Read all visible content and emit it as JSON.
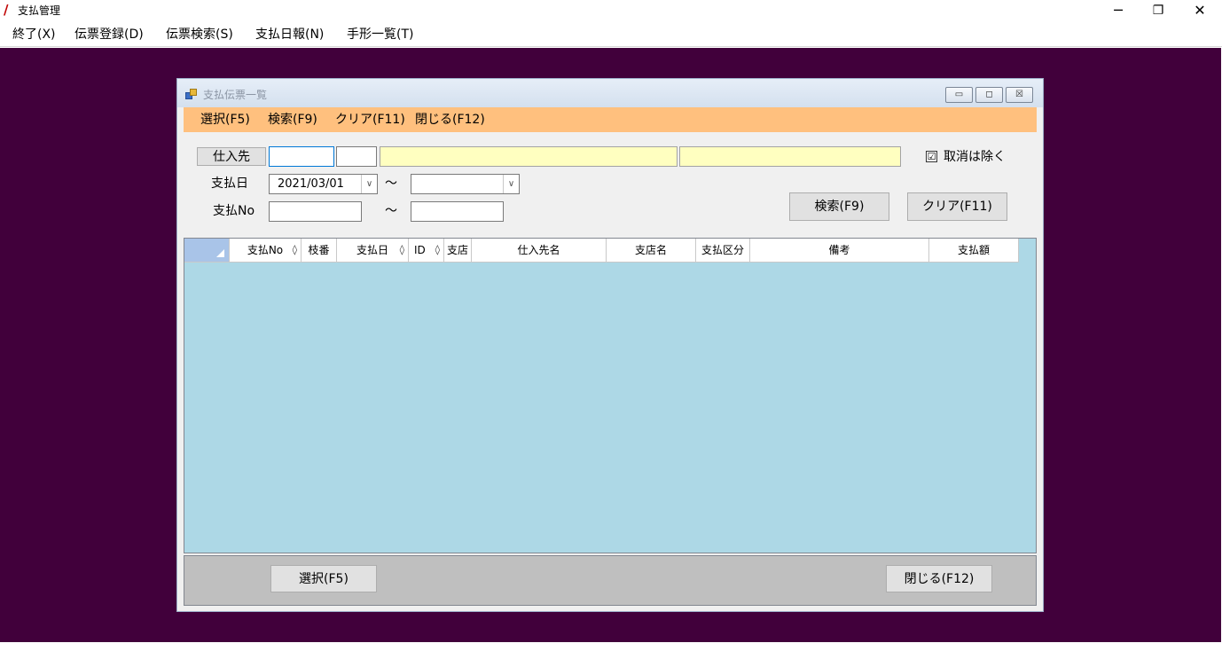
{
  "app": {
    "title": "支払管理",
    "icon": "app-logo-icon",
    "controls": {
      "minimize": "─",
      "restore": "❐",
      "close": "✕"
    }
  },
  "menubar": {
    "items": [
      "終了(X)",
      "伝票登録(D)",
      "伝票検索(S)",
      "支払日報(N)",
      "手形一覧(T)"
    ]
  },
  "child": {
    "title": "支払伝票一覧",
    "controls": {
      "minimize": "▭",
      "restore": "◻",
      "close": "☒"
    },
    "menu": [
      "選択(F5)",
      "検索(F9)",
      "クリア(F11)",
      "閉じる(F12)"
    ]
  },
  "form": {
    "supplier_button": "仕入先",
    "supplier_code": "",
    "supplier_branch": "",
    "supplier_name": "",
    "supplier_branch_name": "",
    "exclude_cancel_label": "取消は除く",
    "exclude_cancel_checked": "☑",
    "pay_date_label": "支払日",
    "pay_date_from": "2021/03/01",
    "pay_date_to": "",
    "tilde": "～",
    "pay_no_label": "支払No",
    "pay_no_from": "",
    "pay_no_to": "",
    "search_button": "検索(F9)",
    "clear_button": "クリア(F11)",
    "dropdown_arrow": "∨"
  },
  "grid": {
    "sort_glyph": "◊",
    "columns": [
      {
        "label": "",
        "sortable": false
      },
      {
        "label": "支払No",
        "sortable": true
      },
      {
        "label": "枝番",
        "sortable": false
      },
      {
        "label": "支払日",
        "sortable": true
      },
      {
        "label": "ID",
        "sortable": true
      },
      {
        "label": "支店",
        "sortable": false
      },
      {
        "label": "仕入先名",
        "sortable": false
      },
      {
        "label": "支店名",
        "sortable": false
      },
      {
        "label": "支払区分",
        "sortable": false
      },
      {
        "label": "備考",
        "sortable": false
      },
      {
        "label": "支払額",
        "sortable": false
      }
    ],
    "rows": []
  },
  "bottom": {
    "select_button": "選択(F5)",
    "close_button": "閉じる(F12)"
  },
  "colors": {
    "desktop": "#41003b",
    "child_menu": "#ffc07e",
    "grid_background": "#add8e6",
    "input_highlight": "#ffffc0"
  }
}
